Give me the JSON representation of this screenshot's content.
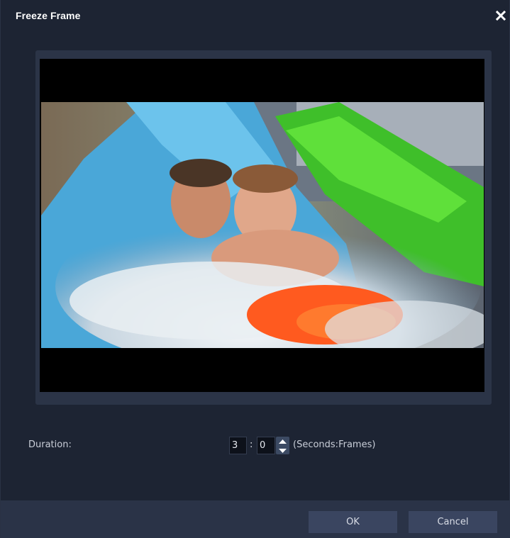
{
  "dialog": {
    "title": "Freeze Frame",
    "close_icon": "close-icon"
  },
  "preview": {
    "image_description": "video-frame"
  },
  "duration": {
    "label": "Duration:",
    "seconds_value": "3",
    "separator": ":",
    "frames_value": "0",
    "stepper_icon": "spin-updown-icon",
    "format_hint": "(Seconds:Frames)"
  },
  "footer": {
    "ok_label": "OK",
    "cancel_label": "Cancel"
  },
  "colors": {
    "background": "#1d2433",
    "footer": "#2a3347",
    "button": "#3a4560",
    "preview_frame": "#2b3447"
  }
}
